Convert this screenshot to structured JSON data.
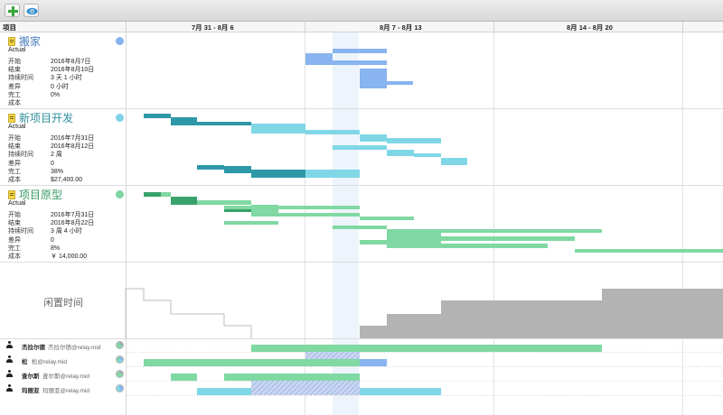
{
  "toolbar": {
    "buttons": [
      {
        "icon": "plus-icon",
        "label": ""
      },
      {
        "icon": "eye-icon",
        "label": ""
      }
    ]
  },
  "header": {
    "column_label": "项目",
    "weeks": [
      "7月 31 - 8月 6",
      "8月 7 - 8月 13",
      "8月 14 - 8月 20"
    ]
  },
  "projects": [
    {
      "title": "搬家",
      "subtitle": "Actual",
      "color": "#88b4ef",
      "dot_color": "#86b3ef",
      "rows": [
        {
          "key": "开始",
          "value": "2016年8月7日"
        },
        {
          "key": "结束",
          "value": "2016年8月10日"
        },
        {
          "key": "持续时间",
          "value": "3 天 1 小时"
        },
        {
          "key": "差异",
          "value": "0 小时"
        },
        {
          "key": "完工",
          "value": "0%"
        },
        {
          "key": "成本",
          "value": ""
        }
      ]
    },
    {
      "title": "新项目开发",
      "subtitle": "Actual",
      "color": "#2e98a8",
      "dot_color": "#7fd3e6",
      "rows": [
        {
          "key": "开始",
          "value": "2016年7月31日"
        },
        {
          "key": "结束",
          "value": "2016年8月12日"
        },
        {
          "key": "持续时间",
          "value": "2 周"
        },
        {
          "key": "差异",
          "value": "0"
        },
        {
          "key": "完工",
          "value": "38%"
        },
        {
          "key": "成本",
          "value": "$27,400.00"
        }
      ]
    },
    {
      "title": "项目原型",
      "subtitle": "Actual",
      "color": "#39a26a",
      "dot_color": "#7fd4a0",
      "rows": [
        {
          "key": "开始",
          "value": "2016年7月31日"
        },
        {
          "key": "结束",
          "value": "2016年8月22日"
        },
        {
          "key": "持续时间",
          "value": "3 周 4 小时"
        },
        {
          "key": "差异",
          "value": "0"
        },
        {
          "key": "完工",
          "value": "8%"
        },
        {
          "key": "成本",
          "value": "￥ 14,000.00"
        }
      ]
    }
  ],
  "idle_time": {
    "label": "闲置时间"
  },
  "resources": [
    {
      "name": "杰拉尔德",
      "email": "杰拉尔德@relay.mid",
      "pie": "pie-1"
    },
    {
      "name": "松",
      "email": "松@relay.mid",
      "pie": "pie-2"
    },
    {
      "name": "查尔斯",
      "email": "查尔斯@relay.mid",
      "pie": "pie-3"
    },
    {
      "name": "玛丽亚",
      "email": "玛丽亚@relay.mid",
      "pie": "pie-4"
    }
  ],
  "colors": {
    "blue": "#88b4ef",
    "teal_dark": "#2e98a8",
    "teal_light": "#7fd7e6",
    "green_dark": "#39a26a",
    "green_light": "#80d8a2",
    "idle_gray": "#b3b3b3",
    "today_highlight": "#eef4fc"
  }
}
